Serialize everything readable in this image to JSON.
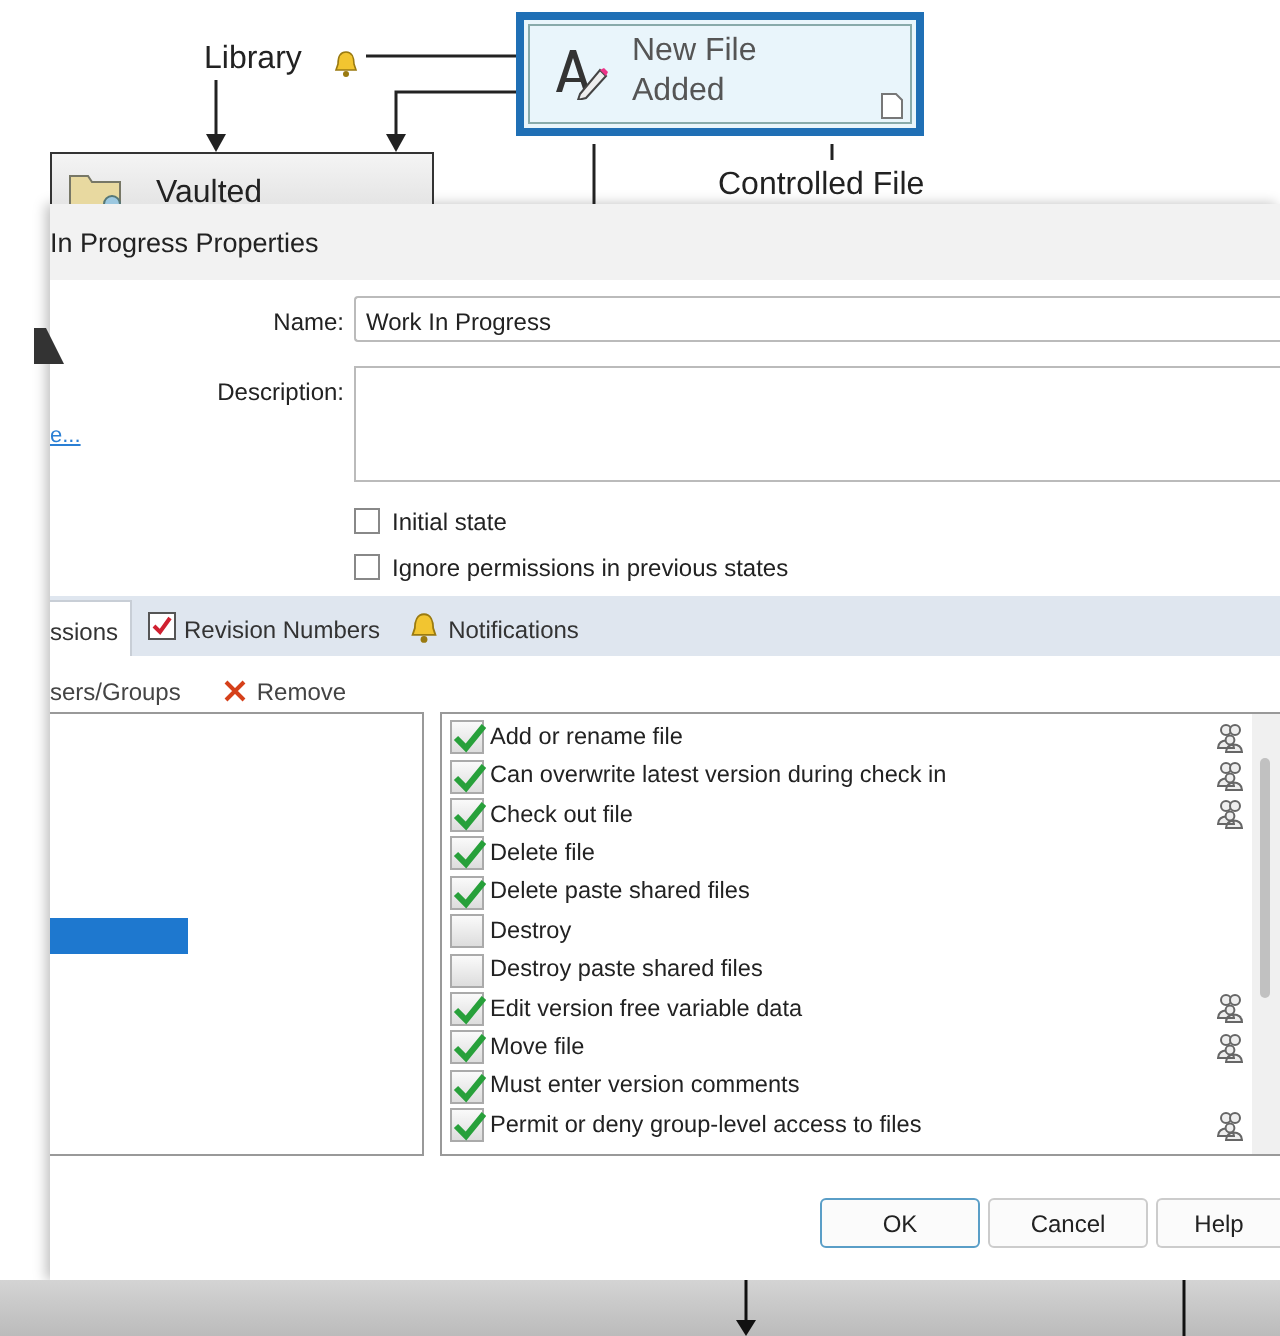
{
  "diagram": {
    "library_label": "Library",
    "node": {
      "title": "New File",
      "subtitle": "Added",
      "selected": true
    },
    "vaulted_label": "Vaulted",
    "transition_label": "Controlled File"
  },
  "dialog": {
    "title": "In Progress Properties",
    "name_label": "Name:",
    "name_value": "Work In Progress",
    "description_label": "Description:",
    "link": "e...",
    "options": [
      {
        "label": "Initial state",
        "checked": false
      },
      {
        "label": "Ignore permissions in previous states",
        "checked": false
      }
    ],
    "tabs": [
      {
        "label": "ssions",
        "selected": true,
        "kind": "plain"
      },
      {
        "label": "Revision Numbers",
        "selected": false,
        "kind": "check"
      },
      {
        "label": "Notifications",
        "selected": false,
        "kind": "bell"
      }
    ],
    "toolbar": [
      {
        "label": "sers/Groups",
        "kind": "plain"
      },
      {
        "label": "Remove",
        "kind": "remove"
      }
    ],
    "permissions": [
      {
        "label": "Add or rename file",
        "checked": true,
        "group": true
      },
      {
        "label": "Can overwrite latest version during check in",
        "checked": true,
        "group": true
      },
      {
        "label": "Check out file",
        "checked": true,
        "group": true
      },
      {
        "label": "Delete file",
        "checked": true,
        "group": false
      },
      {
        "label": "Delete paste shared files",
        "checked": true,
        "group": false
      },
      {
        "label": "Destroy",
        "checked": false,
        "group": false
      },
      {
        "label": "Destroy paste shared files",
        "checked": false,
        "group": false
      },
      {
        "label": "Edit version free variable data",
        "checked": true,
        "group": true
      },
      {
        "label": "Move file",
        "checked": true,
        "group": true
      },
      {
        "label": "Must enter version comments",
        "checked": true,
        "group": false
      },
      {
        "label": "Permit or deny group-level access to files",
        "checked": true,
        "group": true
      }
    ],
    "buttons": [
      {
        "label": "OK",
        "default": true
      },
      {
        "label": "Cancel",
        "default": false
      },
      {
        "label": "Help",
        "default": false
      }
    ]
  }
}
